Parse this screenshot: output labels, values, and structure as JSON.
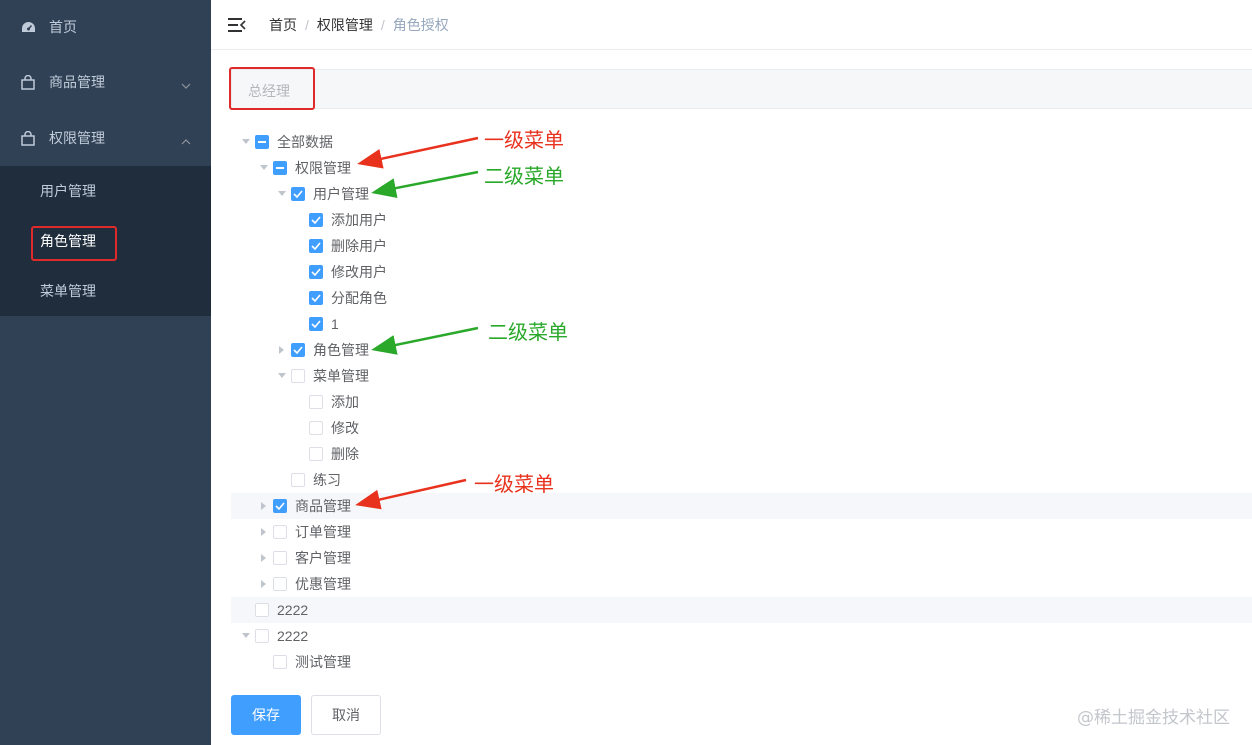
{
  "sidebar": {
    "items": [
      {
        "label": "首页",
        "icon": "dashboard-icon"
      },
      {
        "label": "商品管理",
        "icon": "shopping-bag-icon"
      },
      {
        "label": "权限管理",
        "icon": "lock-icon"
      }
    ],
    "sub_items": [
      "用户管理",
      "角色管理",
      "菜单管理"
    ],
    "active_sub": "角色管理"
  },
  "header": {
    "breadcrumb": [
      "首页",
      "权限管理",
      "角色授权"
    ]
  },
  "role": {
    "name": "总经理"
  },
  "tree": [
    {
      "label": "全部数据",
      "state": "half",
      "caret": "down"
    },
    {
      "label": "权限管理",
      "state": "half",
      "caret": "down"
    },
    {
      "label": "用户管理",
      "state": "checked",
      "caret": "down"
    },
    {
      "label": "添加用户",
      "state": "checked",
      "caret": "none"
    },
    {
      "label": "删除用户",
      "state": "checked",
      "caret": "none"
    },
    {
      "label": "修改用户",
      "state": "checked",
      "caret": "none"
    },
    {
      "label": "分配角色",
      "state": "checked",
      "caret": "none"
    },
    {
      "label": "1",
      "state": "checked",
      "caret": "none"
    },
    {
      "label": "角色管理",
      "state": "checked",
      "caret": "right"
    },
    {
      "label": "菜单管理",
      "state": "unchecked",
      "caret": "down"
    },
    {
      "label": "添加",
      "state": "unchecked",
      "caret": "none"
    },
    {
      "label": "修改",
      "state": "unchecked",
      "caret": "none"
    },
    {
      "label": "删除",
      "state": "unchecked",
      "caret": "none"
    },
    {
      "label": "练习",
      "state": "unchecked",
      "caret": "none"
    },
    {
      "label": "商品管理",
      "state": "checked",
      "caret": "right"
    },
    {
      "label": "订单管理",
      "state": "unchecked",
      "caret": "right"
    },
    {
      "label": "客户管理",
      "state": "unchecked",
      "caret": "right"
    },
    {
      "label": "优惠管理",
      "state": "unchecked",
      "caret": "right"
    },
    {
      "label": "2222",
      "state": "unchecked",
      "caret": "none"
    },
    {
      "label": "2222",
      "state": "unchecked",
      "caret": "down"
    },
    {
      "label": "测试管理",
      "state": "unchecked",
      "caret": "none"
    }
  ],
  "annotations": {
    "level1": "一级菜单",
    "level2": "二级菜单"
  },
  "buttons": {
    "save": "保存",
    "cancel": "取消"
  },
  "watermark": "@稀土掘金技术社区",
  "colors": {
    "sidebar_bg": "#304156",
    "submenu_bg": "#1f2d3d",
    "primary": "#409eff",
    "annotation_red": "#e8321e",
    "annotation_green": "#2aa82a"
  }
}
